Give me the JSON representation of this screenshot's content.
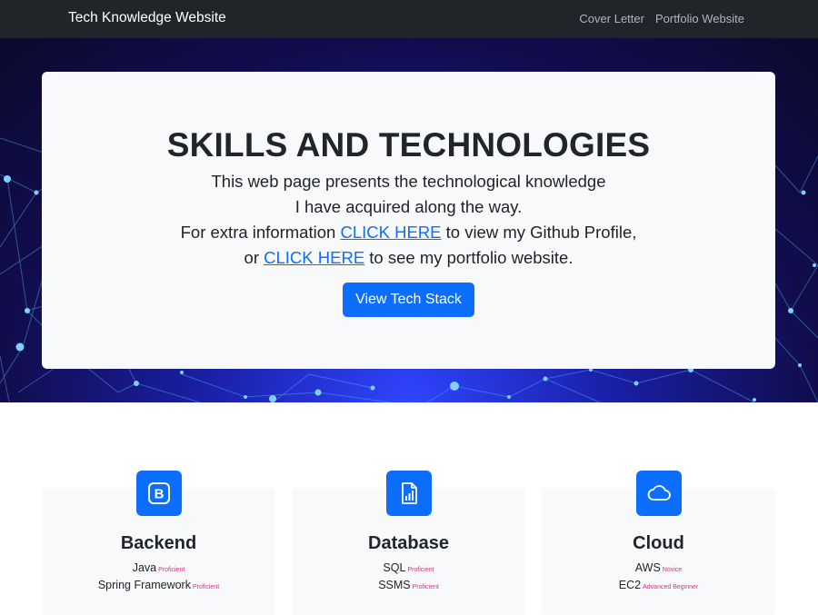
{
  "navbar": {
    "brand": "Tech Knowledge Website",
    "links": [
      {
        "label": "Cover Letter"
      },
      {
        "label": "Portfolio Website"
      }
    ]
  },
  "hero": {
    "title": "SKILLS AND TECHNOLOGIES",
    "line1": "This web page presents the technological knowledge",
    "line2": "I have acquired along the way.",
    "line3_pre": "For extra information ",
    "line3_link": "CLICK HERE",
    "line3_post": " to view my Github Profile,",
    "line4_pre": "or ",
    "line4_link": "CLICK HERE",
    "line4_post": " to see my portfolio website.",
    "button_label": "View Tech Stack"
  },
  "features": [
    {
      "icon": "bootstrap-icon",
      "title": "Backend",
      "skills": [
        {
          "name": "Java",
          "level": "Proficient"
        },
        {
          "name": "Spring Framework",
          "level": "Proficient"
        }
      ]
    },
    {
      "icon": "file-chart-icon",
      "title": "Database",
      "skills": [
        {
          "name": "SQL",
          "level": "Proficient"
        },
        {
          "name": "SSMS",
          "level": "Proficient"
        }
      ]
    },
    {
      "icon": "cloud-icon",
      "title": "Cloud",
      "skills": [
        {
          "name": "AWS",
          "level": "Novice"
        },
        {
          "name": "EC2",
          "level": "Advanced Beginner"
        }
      ]
    }
  ],
  "colors": {
    "navbar_bg": "#212529",
    "primary": "#0d6efd",
    "level_text": "#d63384",
    "card_bg": "#f8f9fa"
  }
}
